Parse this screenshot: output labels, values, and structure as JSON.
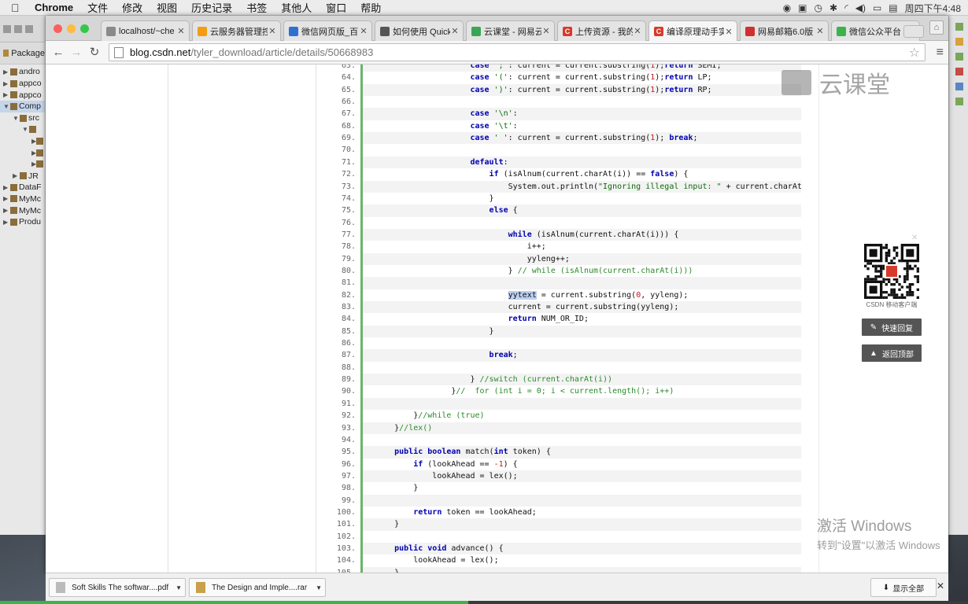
{
  "menubar": {
    "app": "Chrome",
    "items": [
      "文件",
      "修改",
      "视图",
      "历史记录",
      "书签",
      "其他人",
      "窗口",
      "帮助"
    ],
    "clock": "周四下午4:48"
  },
  "eclipse": {
    "tab_label": "Package",
    "tree": [
      {
        "label": "andro",
        "arrow": "▶",
        "indent": 0,
        "selected": false
      },
      {
        "label": "appco",
        "arrow": "▶",
        "indent": 0,
        "selected": false
      },
      {
        "label": "appco",
        "arrow": "▶",
        "indent": 0,
        "selected": false
      },
      {
        "label": "Comp",
        "arrow": "▼",
        "indent": 0,
        "selected": true
      },
      {
        "label": "src",
        "arrow": "▼",
        "indent": 1,
        "selected": false
      },
      {
        "label": "",
        "arrow": "▼",
        "indent": 2,
        "selected": false
      },
      {
        "label": "",
        "arrow": "▶",
        "indent": 3,
        "selected": false
      },
      {
        "label": "",
        "arrow": "▶",
        "indent": 3,
        "selected": false
      },
      {
        "label": "",
        "arrow": "▶",
        "indent": 3,
        "selected": false
      },
      {
        "label": "JR",
        "arrow": "▶",
        "indent": 1,
        "selected": false
      },
      {
        "label": "DataF",
        "arrow": "▶",
        "indent": 0,
        "selected": false
      },
      {
        "label": "MyMc",
        "arrow": "▶",
        "indent": 0,
        "selected": false
      },
      {
        "label": "MyMc",
        "arrow": "▶",
        "indent": 0,
        "selected": false
      },
      {
        "label": "Produ",
        "arrow": "▶",
        "indent": 0,
        "selected": false
      }
    ]
  },
  "tabs": [
    {
      "label": "localhost/~che",
      "fav_color": "#8a8a8a",
      "fav_text": ""
    },
    {
      "label": "云服务器管理控",
      "fav_color": "#f39c12",
      "fav_text": ""
    },
    {
      "label": "微信网页版_百",
      "fav_color": "#2f6fd1",
      "fav_text": ""
    },
    {
      "label": "如何使用 Quick",
      "fav_color": "#555555",
      "fav_text": ""
    },
    {
      "label": "云课堂 - 网易云",
      "fav_color": "#3aa655",
      "fav_text": ""
    },
    {
      "label": "上传资源 - 我的",
      "fav_color": "#d73a2a",
      "fav_text": "C"
    },
    {
      "label": "编译原理动手实",
      "fav_color": "#d73a2a",
      "fav_text": "C"
    },
    {
      "label": "网易邮箱6.0版",
      "fav_color": "#d03030",
      "fav_text": ""
    },
    {
      "label": "微信公众平台",
      "fav_color": "#3cb34a",
      "fav_text": ""
    }
  ],
  "active_tab": 6,
  "address": {
    "host": "blog.csdn.net",
    "path": "/tyler_download/article/details/50668983"
  },
  "watermark_text": "云课堂",
  "qr_label": "CSDN 移动客户端",
  "side_buttons": {
    "reply": "快速回复",
    "top": "返回顶部"
  },
  "activate": {
    "line1": "激活 Windows",
    "line2": "转到\"设置\"以激活 Windows"
  },
  "downloads": {
    "items": [
      "Soft Skills The softwar....pdf",
      "The Design and Imple....rar"
    ],
    "show_all": "显示全部"
  },
  "colors": {
    "accent_green": "#6ab46a",
    "keyword": "#0000b0",
    "string": "#0b6a0b",
    "comment": "#2a8a2a",
    "progress": "#39b54a"
  },
  "progress_fraction": 0.484,
  "code": {
    "first_line": 63,
    "lines": [
      [
        [
          "                      ",
          ""
        ],
        [
          "case",
          "k"
        ],
        [
          " ",
          ""
        ],
        [
          "';'",
          "s"
        ],
        [
          ": current = current.substring(",
          ""
        ],
        [
          "1",
          "n"
        ],
        [
          ");",
          ""
        ],
        [
          "return",
          "k"
        ],
        [
          " SEMI;",
          ""
        ]
      ],
      [
        [
          "                      ",
          ""
        ],
        [
          "case",
          "k"
        ],
        [
          " ",
          ""
        ],
        [
          "'('",
          "s"
        ],
        [
          ": current = current.substring(",
          ""
        ],
        [
          "1",
          "n"
        ],
        [
          ");",
          ""
        ],
        [
          "return",
          "k"
        ],
        [
          " LP;",
          ""
        ]
      ],
      [
        [
          "                      ",
          ""
        ],
        [
          "case",
          "k"
        ],
        [
          " ",
          ""
        ],
        [
          "')'",
          "s"
        ],
        [
          ": current = current.substring(",
          ""
        ],
        [
          "1",
          "n"
        ],
        [
          ");",
          ""
        ],
        [
          "return",
          "k"
        ],
        [
          " RP;",
          ""
        ]
      ],
      [],
      [
        [
          "                      ",
          ""
        ],
        [
          "case",
          "k"
        ],
        [
          " ",
          ""
        ],
        [
          "'\\n'",
          "s"
        ],
        [
          ":",
          ""
        ]
      ],
      [
        [
          "                      ",
          ""
        ],
        [
          "case",
          "k"
        ],
        [
          " ",
          ""
        ],
        [
          "'\\t'",
          "s"
        ],
        [
          ":",
          ""
        ]
      ],
      [
        [
          "                      ",
          ""
        ],
        [
          "case",
          "k"
        ],
        [
          " ",
          ""
        ],
        [
          "' '",
          "s"
        ],
        [
          ": current = current.substring(",
          ""
        ],
        [
          "1",
          "n"
        ],
        [
          "); ",
          ""
        ],
        [
          "break",
          "k"
        ],
        [
          ";",
          ""
        ]
      ],
      [],
      [
        [
          "                      ",
          ""
        ],
        [
          "default",
          "k"
        ],
        [
          ":",
          ""
        ]
      ],
      [
        [
          "                          ",
          ""
        ],
        [
          "if",
          "k"
        ],
        [
          " (isAlnum(current.charAt(i)) == ",
          ""
        ],
        [
          "false",
          "k"
        ],
        [
          ") {",
          ""
        ]
      ],
      [
        [
          "                              ",
          ""
        ],
        [
          "System.out.println(",
          ""
        ],
        [
          "\"Ignoring illegal input: \"",
          "s"
        ],
        [
          " + current.charAt(i));",
          ""
        ]
      ],
      [
        [
          "                          ",
          ""
        ],
        [
          "}",
          ""
        ]
      ],
      [
        [
          "                          ",
          ""
        ],
        [
          "else",
          "k"
        ],
        [
          " {",
          ""
        ]
      ],
      [],
      [
        [
          "                              ",
          ""
        ],
        [
          "while",
          "k"
        ],
        [
          " (isAlnum(current.charAt(i))) {",
          ""
        ]
      ],
      [
        [
          "                                  ",
          ""
        ],
        [
          "i++;",
          ""
        ]
      ],
      [
        [
          "                                  ",
          ""
        ],
        [
          "yyleng++;",
          ""
        ]
      ],
      [
        [
          "                              ",
          ""
        ],
        [
          "} ",
          ""
        ],
        [
          "// while (isAlnum(current.charAt(i)))",
          "c"
        ]
      ],
      [],
      [
        [
          "                              ",
          ""
        ],
        [
          "yytext",
          "hl"
        ],
        [
          " = current.substring(",
          ""
        ],
        [
          "0",
          "n"
        ],
        [
          ", yyleng);",
          ""
        ]
      ],
      [
        [
          "                              ",
          ""
        ],
        [
          "current = current.substring(yyleng);",
          ""
        ]
      ],
      [
        [
          "                              ",
          ""
        ],
        [
          "return",
          "k"
        ],
        [
          " NUM_OR_ID;",
          ""
        ]
      ],
      [
        [
          "                          ",
          ""
        ],
        [
          "}",
          ""
        ]
      ],
      [],
      [
        [
          "                          ",
          ""
        ],
        [
          "break",
          "k"
        ],
        [
          ";",
          ""
        ]
      ],
      [],
      [
        [
          "                      ",
          ""
        ],
        [
          "} ",
          ""
        ],
        [
          "//switch (current.charAt(i))",
          "c"
        ]
      ],
      [
        [
          "                  ",
          ""
        ],
        [
          "}",
          ""
        ],
        [
          "//  for (int i = 0; i < current.length(); i++)",
          "c"
        ]
      ],
      [],
      [
        [
          "          ",
          ""
        ],
        [
          "}",
          ""
        ],
        [
          "//while (true)",
          "c"
        ]
      ],
      [
        [
          "      ",
          ""
        ],
        [
          "}",
          ""
        ],
        [
          "//lex()",
          "c"
        ]
      ],
      [],
      [
        [
          "      ",
          ""
        ],
        [
          "public",
          "k"
        ],
        [
          " ",
          ""
        ],
        [
          "boolean",
          "k"
        ],
        [
          " match(",
          ""
        ],
        [
          "int",
          "k"
        ],
        [
          " token) {",
          ""
        ]
      ],
      [
        [
          "          ",
          ""
        ],
        [
          "if",
          "k"
        ],
        [
          " (lookAhead == ",
          ""
        ],
        [
          "-1",
          "n"
        ],
        [
          ") {",
          ""
        ]
      ],
      [
        [
          "              ",
          ""
        ],
        [
          "lookAhead = lex();",
          ""
        ]
      ],
      [
        [
          "          ",
          ""
        ],
        [
          "}",
          ""
        ]
      ],
      [],
      [
        [
          "          ",
          ""
        ],
        [
          "return",
          "k"
        ],
        [
          " token == lookAhead;",
          ""
        ]
      ],
      [
        [
          "      ",
          ""
        ],
        [
          "}",
          ""
        ]
      ],
      [],
      [
        [
          "      ",
          ""
        ],
        [
          "public",
          "k"
        ],
        [
          " ",
          ""
        ],
        [
          "void",
          "k"
        ],
        [
          " advance() {",
          ""
        ]
      ],
      [
        [
          "          ",
          ""
        ],
        [
          "lookAhead = lex();",
          ""
        ]
      ],
      [
        [
          "      ",
          ""
        ],
        [
          "}",
          ""
        ]
      ]
    ]
  }
}
